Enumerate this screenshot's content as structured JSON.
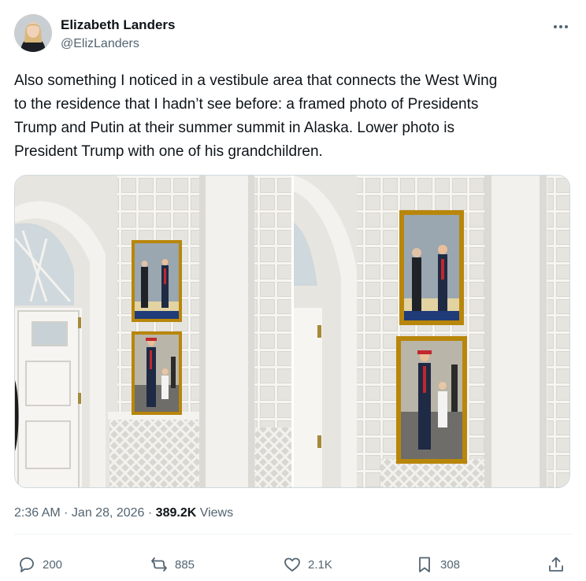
{
  "author": {
    "name": "Elizabeth Landers",
    "handle": "@ElizLanders"
  },
  "tweet": {
    "text_lines": [
      "Also something I noticed in a vestibule area that connects the West Wing",
      "to the residence that I hadn’t see before: a framed photo of Presidents",
      "Trump and Putin at their summer summit in Alaska. Lower photo is",
      "President Trump with one of his grandchildren."
    ]
  },
  "meta": {
    "time": "2:36 AM",
    "sep1": " · ",
    "date": "Jan 28, 2026",
    "sep2": " · ",
    "views_count": "389.2K",
    "views_label": " Views"
  },
  "actions": {
    "replies": "200",
    "reposts": "885",
    "likes": "2.1K",
    "bookmarks": "308"
  },
  "icons": {
    "more": "more-icon",
    "reply": "reply-icon",
    "repost": "repost-icon",
    "like": "like-icon",
    "bookmark": "bookmark-icon",
    "share": "share-icon"
  },
  "colors": {
    "text": "#0f1419",
    "secondary": "#536471",
    "frame_gold": "#b8860b",
    "wall": "#e9e7e2"
  }
}
